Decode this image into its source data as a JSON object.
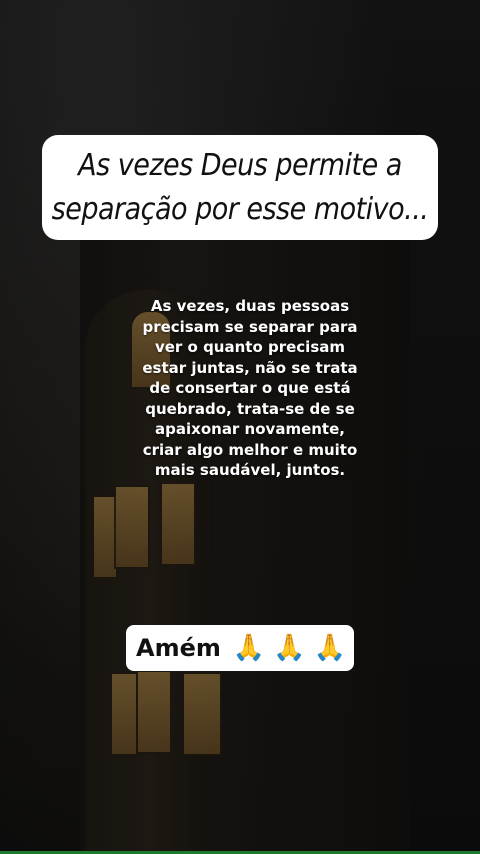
{
  "headline": {
    "text": "As vezes Deus permite a separação por esse motivo..."
  },
  "body_text": "As vezes, duas pessoas precisam se separar para ver o quanto precisam estar juntas, não se trata de consertar o que está quebrado, trata-se de se apaixonar novamente, criar algo melhor e muito mais saudável,  juntos.",
  "sticker": {
    "label": "Amém",
    "emojis": "🙏🙏🙏"
  },
  "colors": {
    "background": "#141414",
    "card": "#ffffff",
    "text_dark": "#111111",
    "text_light": "#ffffff",
    "progress_bar": "#1f7a2e"
  }
}
